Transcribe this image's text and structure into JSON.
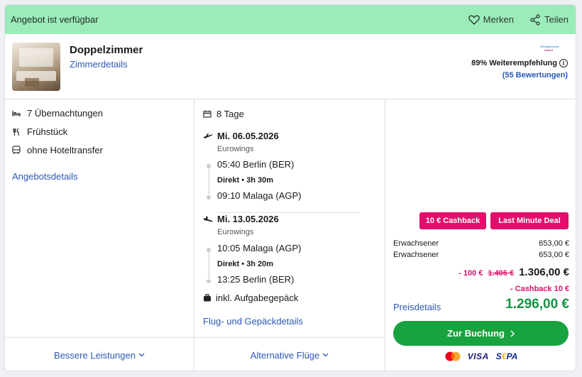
{
  "banner": {
    "text": "Angebot ist verfügbar",
    "merken": "Merken",
    "teilen": "Teilen"
  },
  "room": {
    "title": "Doppelzimmer",
    "details_link": "Zimmerdetails",
    "rating_logo_line1": "HolidayCheck",
    "rating_logo_line2": "Award",
    "recommendation": "89% Weiterempfehlung",
    "reviews": "(55 Bewertungen)"
  },
  "features": {
    "nights": "7 Übernachtungen",
    "board": "Frühstück",
    "transfer": "ohne Hoteltransfer",
    "offer_details": "Angebotsdetails",
    "better_services": "Bessere Leistungen"
  },
  "flights": {
    "duration": "8 Tage",
    "outbound": {
      "date": "Mi. 06.05.2026",
      "airline": "Eurowings",
      "dep": "05:40 Berlin (BER)",
      "direct": "Direkt • 3h 30m",
      "arr": "09:10 Malaga (AGP)"
    },
    "inbound": {
      "date": "Mi. 13.05.2026",
      "airline": "Eurowings",
      "dep": "10:05 Malaga (AGP)",
      "direct": "Direkt • 3h 20m",
      "arr": "13:25 Berlin (BER)"
    },
    "baggage": "inkl. Aufgabegepäck",
    "details_link": "Flug- und Gepäckdetails",
    "alternatives": "Alternative Flüge"
  },
  "pricing": {
    "badge_cashback": "10 € Cashback",
    "badge_lastminute": "Last Minute Deal",
    "pax": [
      {
        "label": "Erwachsener",
        "price": "653,00 €"
      },
      {
        "label": "Erwachsener",
        "price": "653,00 €"
      }
    ],
    "discount": "- 100 €",
    "old_price": "1.406 €",
    "subtotal": "1.306,00 €",
    "cashback": "- Cashback 10 €",
    "details_link": "Preisdetails",
    "total": "1.296,00 €",
    "book_button": "Zur Buchung",
    "payments": {
      "visa": "VISA",
      "sepa_s": "S",
      "sepa_e": "€",
      "sepa_pa": "PA"
    }
  },
  "colors": {
    "banner_bg": "#9cecb9",
    "link": "#2b57b5",
    "accent_pink": "#e30d6b",
    "total_green": "#169346",
    "button_green": "#18a340"
  }
}
